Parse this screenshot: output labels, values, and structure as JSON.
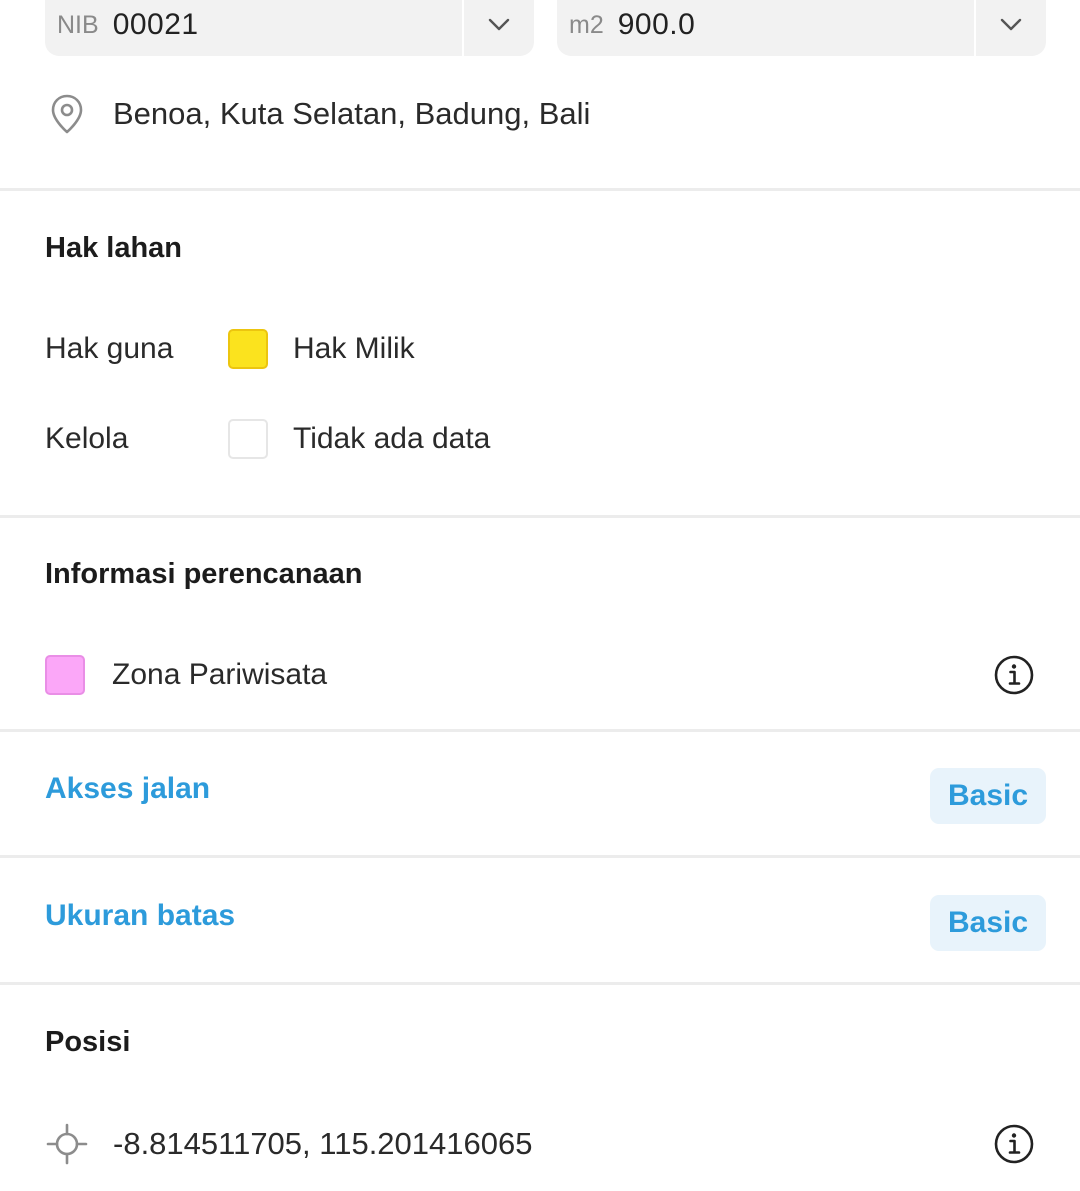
{
  "parcel": {
    "nib_prefix": "NIB",
    "nib_value": "00021",
    "area_prefix": "m2",
    "area_value": "900.0"
  },
  "location": {
    "address": "Benoa, Kuta Selatan, Badung, Bali",
    "icon": "map-pin-icon"
  },
  "land_rights": {
    "title": "Hak lahan",
    "rows": [
      {
        "label": "Hak guna",
        "value": "Hak Milik",
        "color": "#fbe31e"
      },
      {
        "label": "Kelola",
        "value": "Tidak ada data",
        "color": "#ffffff"
      }
    ]
  },
  "planning": {
    "title": "Informasi perencanaan",
    "zone_label": "Zona Pariwisata",
    "zone_color": "#fba7f8"
  },
  "road_access": {
    "title": "Akses jalan",
    "badge": "Basic"
  },
  "boundary_size": {
    "title": "Ukuran batas",
    "badge": "Basic"
  },
  "position": {
    "title": "Posisi",
    "coordinates": "-8.814511705, 115.201416065",
    "icon": "crosshair-icon"
  },
  "colors": {
    "accent": "#2d9bdb",
    "badge_bg": "#e8f3fb",
    "divider": "#ececec"
  }
}
